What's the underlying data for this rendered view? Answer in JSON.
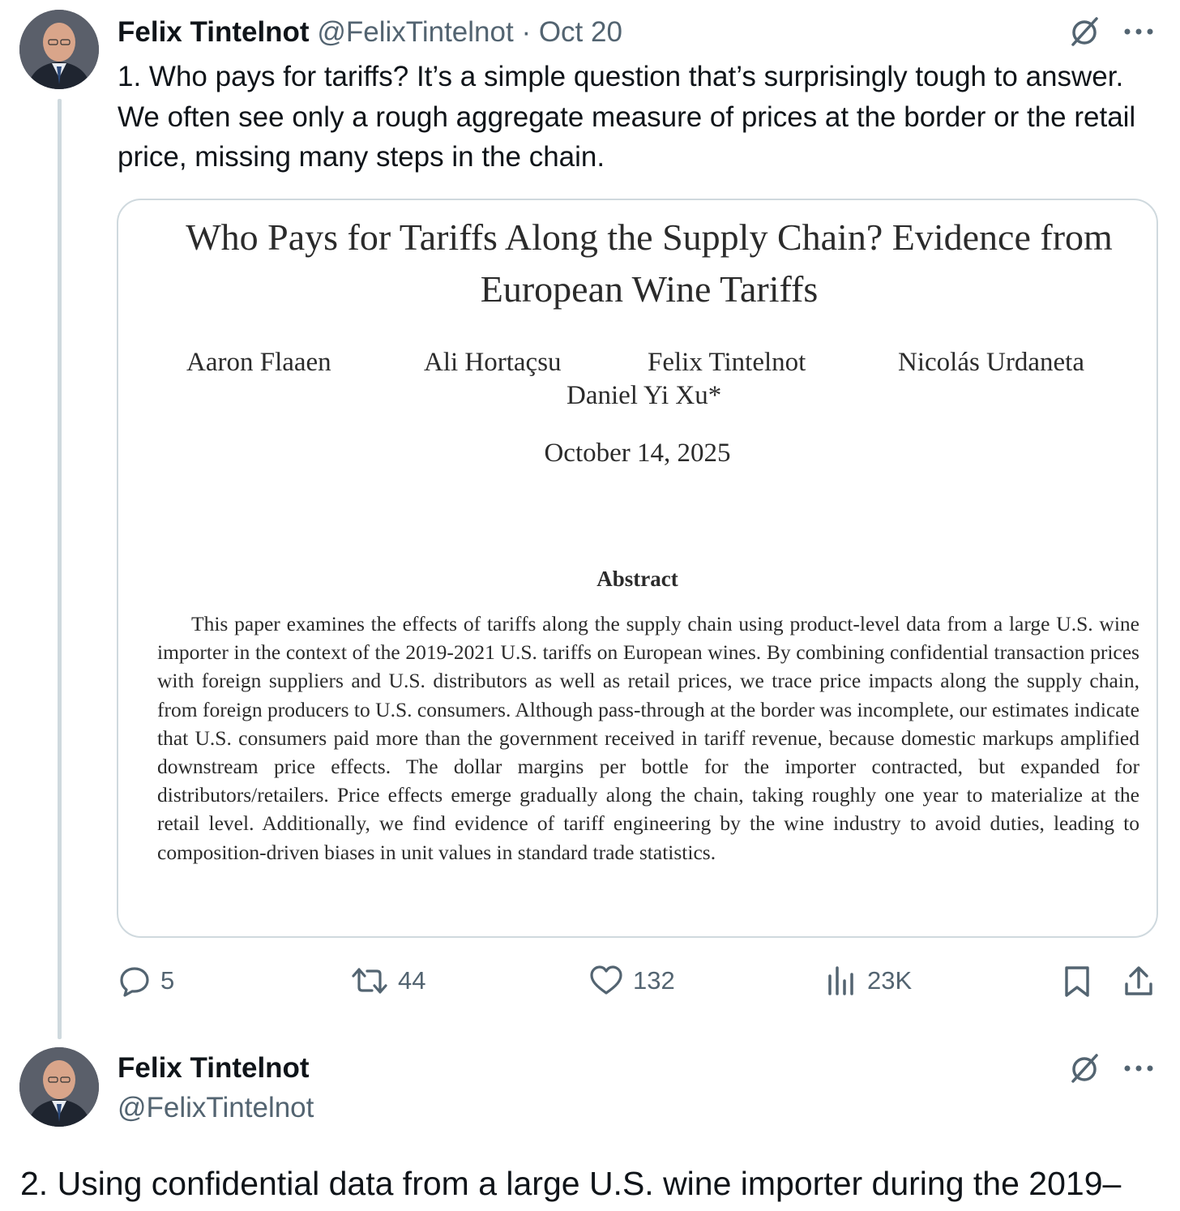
{
  "tweet1": {
    "author_name": "Felix Tintelnot",
    "handle": "@FelixTintelnot",
    "separator": "·",
    "date": "Oct 20",
    "text": "1. Who pays for tariffs? It’s a simple question that’s surprisingly tough to answer. We often see only a rough aggregate measure of prices at the border or the retail price, missing many steps in the chain.",
    "paper": {
      "title_line1": "Who Pays for Tariffs Along the Supply Chain? Evidence from",
      "title_line2": "European Wine Tariffs",
      "authors": [
        "Aaron Flaaen",
        "Ali Hortaçsu",
        "Felix Tintelnot",
        "Nicolás Urdaneta",
        "Daniel Yi Xu*"
      ],
      "date": "October 14, 2025",
      "abstract_heading": "Abstract",
      "abstract": "This paper examines the effects of tariffs along the supply chain using product-level data from a large U.S. wine importer in the context of the 2019-2021 U.S. tariffs on European wines. By combining confidential transaction prices with foreign suppliers and U.S. distributors as well as retail prices, we trace price impacts along the supply chain, from foreign producers to U.S. consumers. Although pass-through at the border was incomplete, our estimates indicate that U.S. consumers paid more than the government received in tariff revenue, because domestic markups amplified downstream price effects. The dollar margins per bottle for the importer contracted, but expanded for distributors/retailers. Price effects emerge gradually along the chain, taking roughly one year to materialize at the retail level. Additionally, we find evidence of tariff engineering by the wine industry to avoid duties, leading to composition-driven biases in unit values in standard trade statistics."
    },
    "actions": {
      "replies": "5",
      "reposts": "44",
      "likes": "132",
      "views": "23K"
    },
    "icons": [
      "grok-icon",
      "more-icon",
      "reply-icon",
      "repost-icon",
      "like-icon",
      "views-icon",
      "bookmark-icon",
      "share-icon"
    ]
  },
  "tweet2": {
    "author_name": "Felix Tintelnot",
    "handle": "@FelixTintelnot",
    "text": "2. Using confidential data from a large U.S. wine importer during the 2019–"
  },
  "colors": {
    "text_primary": "#0f1419",
    "text_secondary": "#536471",
    "border": "#cfd9de"
  }
}
